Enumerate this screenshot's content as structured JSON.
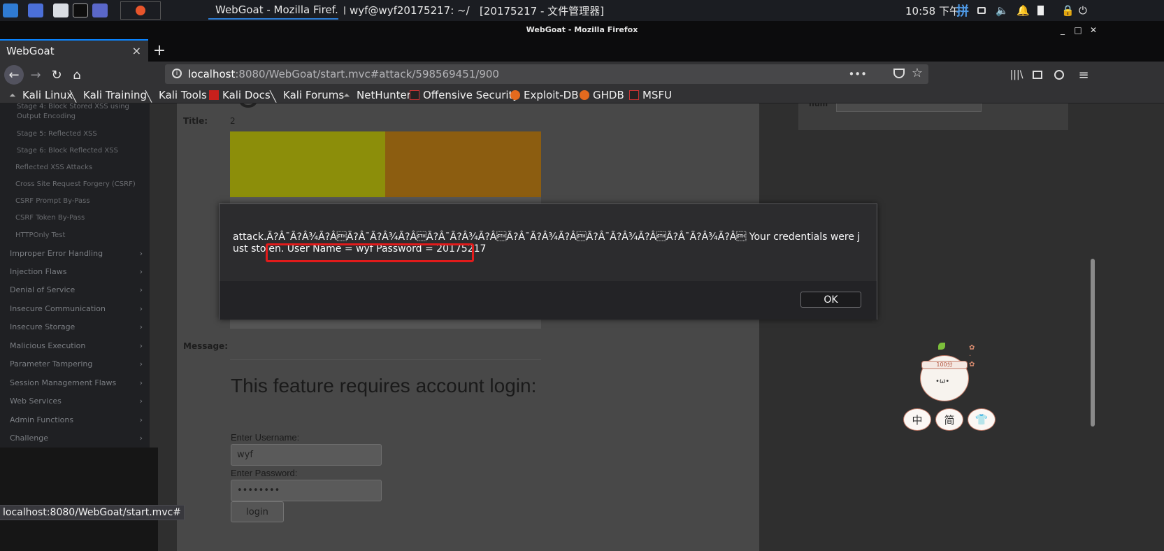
{
  "taskbar": {
    "tasks": [
      {
        "label": "WebGoat - Mozilla Firef...",
        "icon": "firefox-icon"
      },
      {
        "label": "wyf@wyf20175217: ~/...",
        "icon": "terminal-icon"
      },
      {
        "label": "[20175217 - 文件管理器]",
        "icon": "file-manager-icon"
      }
    ],
    "clock": "10:58 下午",
    "ime": "拼"
  },
  "window": {
    "title": "WebGoat - Mozilla Firefox"
  },
  "browser": {
    "tab_title": "WebGoat",
    "tab_close": "×",
    "new_tab": "+",
    "url_host": "localhost",
    "url_rest": ":8080/WebGoat/start.mvc#attack/598569451/900",
    "url_menu": "•••",
    "bookmarks": [
      {
        "label": "Kali Linux"
      },
      {
        "label": "Kali Training"
      },
      {
        "label": "Kali Tools"
      },
      {
        "label": "Kali Docs"
      },
      {
        "label": "Kali Forums"
      },
      {
        "label": "NetHunter"
      },
      {
        "label": "Offensive Security"
      },
      {
        "label": "Exploit-DB"
      },
      {
        "label": "GHDB"
      },
      {
        "label": "MSFU"
      }
    ],
    "status_url": "localhost:8080/WebGoat/start.mvc#"
  },
  "sidebar": {
    "sub_items": [
      "Stage 4: Block Stored XSS using Output Encoding",
      "Stage 5: Reflected XSS",
      "Stage 6: Block Reflected XSS"
    ],
    "lessons": [
      "Reflected XSS Attacks",
      "Cross Site Request Forgery (CSRF)",
      "CSRF Prompt By-Pass",
      "CSRF Token By-Pass",
      "HTTPOnly Test"
    ],
    "categories": [
      "Improper Error Handling",
      "Injection Flaws",
      "Denial of Service",
      "Insecure Communication",
      "Insecure Storage",
      "Malicious Execution",
      "Parameter Tampering",
      "Session Management Flaws",
      "Web Services",
      "Admin Functions",
      "Challenge"
    ],
    "chevron": "›"
  },
  "main": {
    "title_label": "Title:",
    "title_value": "2",
    "message_label": "Message:",
    "feature_heading": "This feature requires account login:",
    "username_label": "Enter Username:",
    "username_value": "wyf",
    "password_label": "Enter Password:",
    "password_value": "••••••••",
    "login_label": "login",
    "right_label": "num"
  },
  "mascot": {
    "band_text": "100分",
    "buttons": [
      "中",
      "简",
      "👕"
    ]
  },
  "dialog": {
    "message_prefix": "attack.Ã?Â¯Ã?Â¾Ã?Â\u0002Ã?Â¯Ã?Â¾Ã?Â\u0002Ã?Â¯Ã?Â¾Ã?Â\u0002Ã?Â¯Ã?Â¾Ã?Â\u0002Ã?Â¯Ã?Â¾Ã?Â\u0002Ã?Â¯Ã?Â¾Ã?Â\u0002 Your credentials were just stolen.",
    "credentials_text": "User Name = wyf Password = 20175217",
    "ok_label": "OK",
    "highlight_color": "#e21b1b"
  }
}
